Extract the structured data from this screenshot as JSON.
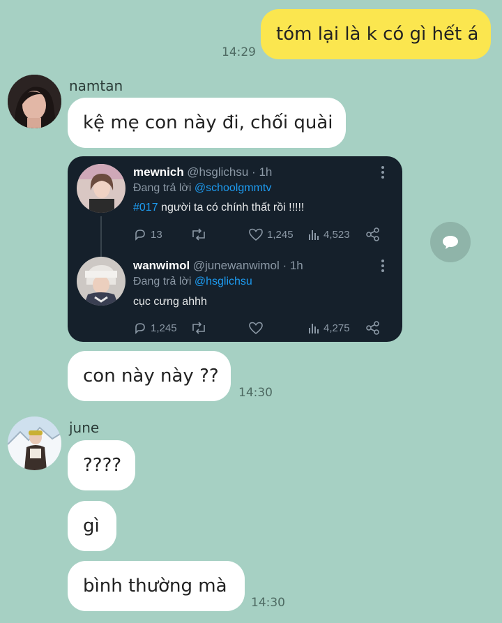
{
  "messages": [
    {
      "sender": "me",
      "text": "tóm lại là k có gì hết á",
      "time": "14:29"
    },
    {
      "sender": "namtan",
      "text": "kệ mẹ con này đi, chối quài"
    },
    {
      "sender": "namtan",
      "text": "con này này ??",
      "time": "14:30"
    },
    {
      "sender": "june",
      "text": "????"
    },
    {
      "sender": "june",
      "text": "gì"
    },
    {
      "sender": "june",
      "text": "bình thường mà",
      "time": "14:30"
    }
  ],
  "senders": {
    "namtan": "namtan",
    "june": "june"
  },
  "tweet_card": {
    "tweet1": {
      "name": "mewnich",
      "handle": "@hsglichsu · 1h",
      "reply_prefix": "Đang trả lời ",
      "reply_to": "@schoolgmmtv",
      "hashtag": "#017",
      "text": " người ta có chính thất rồi !!!!!",
      "replies": "13",
      "likes": "1,245",
      "views": "4,523"
    },
    "tweet2": {
      "name": "wanwimol",
      "handle": "@junewanwimol · 1h",
      "reply_prefix": "Đang trả lời ",
      "reply_to": "@hsglichsu",
      "text": "cục cưng ahhh",
      "replies": "1,245",
      "views": "4,275"
    }
  },
  "colors": {
    "background": "#a6d0c3",
    "my_bubble": "#fbe64f",
    "their_bubble": "#ffffff",
    "card_bg": "#15202b",
    "link": "#1d9bf0"
  },
  "icons": [
    "share-icon",
    "reply-icon",
    "retweet-icon",
    "heart-icon",
    "views-icon",
    "tweet-share-icon",
    "more-icon"
  ]
}
